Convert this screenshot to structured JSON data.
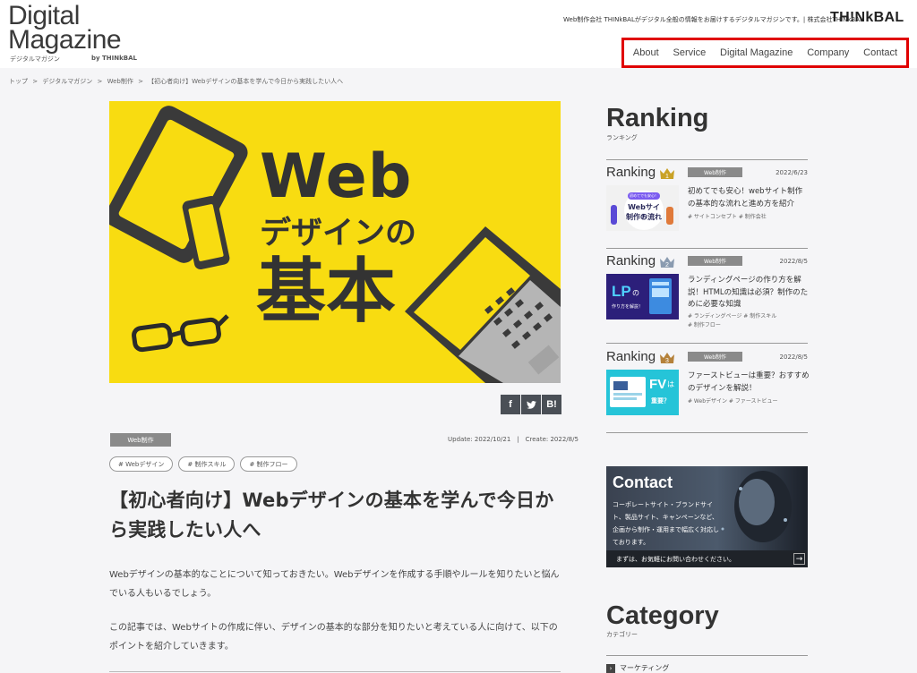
{
  "header": {
    "logo_line1": "Digital",
    "logo_line2": "Magazine",
    "logo_sub": "デジタルマガジン",
    "logo_by": "by THINkBAL",
    "tagline": "Web制作会社 THINkBALがデジタル全般の情報をお届けするデジタルマガジンです。| 株式会社THINkBAL",
    "brand": "TH!NkBAL",
    "nav": [
      "About",
      "Service",
      "Digital Magazine",
      "Company",
      "Contact"
    ]
  },
  "breadcrumb": [
    "トップ",
    ">",
    "デジタルマガジン",
    ">",
    "Web制作",
    ">",
    "【初心者向け】Webデザインの基本を学んで今日から実践したい人へ"
  ],
  "hero": {
    "line1": "Web",
    "line2": "デザインの",
    "line3": "基本",
    "bg_color": "#f8dc11"
  },
  "share": [
    "f",
    "t",
    "B!"
  ],
  "article": {
    "category": "Web制作",
    "update": "Update: 2022/10/21",
    "separator": "|",
    "create": "Create: 2022/8/5",
    "tags": [
      "# Webデザイン",
      "# 制作スキル",
      "# 制作フロー"
    ],
    "title": "【初心者向け】Webデザインの基本を学んで今日から実践したい人へ",
    "paragraphs": [
      "Webデザインの基本的なことについて知っておきたい。Webデザインを作成する手順やルールを知りたいと悩んでいる人もいるでしょう。",
      "この記事では、Webサイトの作成に伴い、デザインの基本的な部分を知りたいと考えている人に向けて、以下のポイントを紹介していきます。"
    ]
  },
  "sidebar": {
    "ranking_title": "Ranking",
    "ranking_sub": "ランキング",
    "ranking_items": [
      {
        "label": "Ranking",
        "rank": "1",
        "crown_color": "#c9a227",
        "category": "Web制作",
        "date": "2022/6/23",
        "title": "初めてでも安心！webサイト制作の基本的な流れと進め方を紹介",
        "tags": "# サイトコンセプト  # 制作会社",
        "thumb_line1": "初めてでも安心！",
        "thumb_line2": "Webサイト",
        "thumb_line3": "制作の流れ"
      },
      {
        "label": "Ranking",
        "rank": "2",
        "crown_color": "#8a9bb0",
        "category": "Web制作",
        "date": "2022/8/5",
        "title": "ランディングページの作り方を解説！HTMLの知識は必須？制作のために必要な知識",
        "tags": "# ランディングページ  # 制作スキル\n# 制作フロー",
        "thumb_line1": "LP",
        "thumb_line2": "の",
        "thumb_line3": "作り方を解説！"
      },
      {
        "label": "Ranking",
        "rank": "3",
        "crown_color": "#b5813a",
        "category": "Web制作",
        "date": "2022/8/5",
        "title": "ファーストビューは重要？おすすめのデザインを解説！",
        "tags": "# Webデザイン  # ファーストビュー",
        "thumb_line1": "FV",
        "thumb_line2": "は",
        "thumb_line3": "重要？"
      }
    ],
    "contact": {
      "title": "Contact",
      "body": "コーポレートサイト・ブランドサイト、製品サイト、キャンペーンなど、企画から制作・運用まで幅広く対応しております。",
      "bar_text": "まずは、お気軽にお問い合わせください。",
      "arrow": "→"
    },
    "category_title": "Category",
    "category_sub": "カテゴリー",
    "category_first": "マーケティング"
  }
}
